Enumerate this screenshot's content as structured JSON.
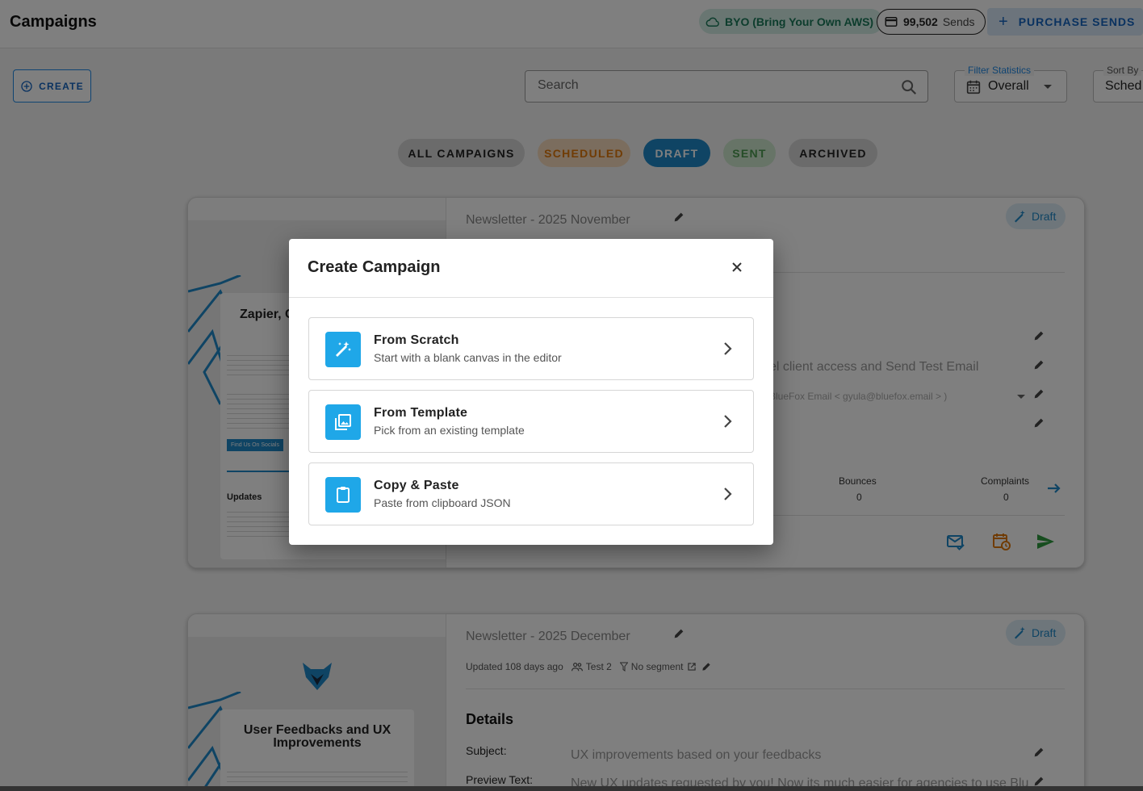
{
  "header": {
    "title": "Campaigns",
    "byo_label": "BYO (Bring Your Own AWS)",
    "sends_count": "99,502",
    "sends_label": "Sends",
    "purchase_label": "PURCHASE SENDS"
  },
  "toolbar": {
    "create_label": "CREATE",
    "search_placeholder": "Search",
    "filter_label": "Filter Statistics",
    "filter_value": "Overall",
    "sort_label": "Sort By",
    "sort_value": "Sched"
  },
  "tabs": [
    {
      "label": "ALL CAMPAIGNS"
    },
    {
      "label": "SCHEDULED"
    },
    {
      "label": "DRAFT"
    },
    {
      "label": "SENT"
    },
    {
      "label": "ARCHIVED"
    }
  ],
  "campaigns": [
    {
      "title": "Newsletter - 2025 November",
      "status": "Draft",
      "preview_heading": "Zapier, C",
      "preview_button": "Find Us On Socials",
      "preview_section": "Updates",
      "subject_fragment": "el client access and Send Test Email",
      "from_fragment": "BlueFox Email < gyula@bluefox.email > )",
      "stats": [
        {
          "label": "Bounces",
          "value": "0"
        },
        {
          "label": "Complaints",
          "value": "0"
        }
      ]
    },
    {
      "title": "Newsletter - 2025 December",
      "status": "Draft",
      "updated": "Updated 108 days ago",
      "audience": "Test 2",
      "segment": "No segment",
      "details_heading": "Details",
      "subject_label": "Subject:",
      "subject_value": "UX improvements based on your feedbacks",
      "preview_label": "Preview Text:",
      "preview_value": "New UX updates requested by you! Now its much easier for agencies to use Blu",
      "preview_heading": "User Feedbacks and UX Improvements"
    }
  ],
  "modal": {
    "title": "Create Campaign",
    "options": [
      {
        "title": "From Scratch",
        "subtitle": "Start with a blank canvas in the editor",
        "icon": "magic-wand-icon"
      },
      {
        "title": "From Template",
        "subtitle": "Pick from an existing template",
        "icon": "image-collection-icon"
      },
      {
        "title": "Copy & Paste",
        "subtitle": "Paste from clipboard JSON",
        "icon": "clipboard-icon"
      }
    ]
  },
  "colors": {
    "accent": "#1e88e5",
    "option_icon_bg": "#1fa7e8",
    "draft_tab": "#1e88c8",
    "scheduled": "#e0780b",
    "sent": "#4c9a50"
  }
}
